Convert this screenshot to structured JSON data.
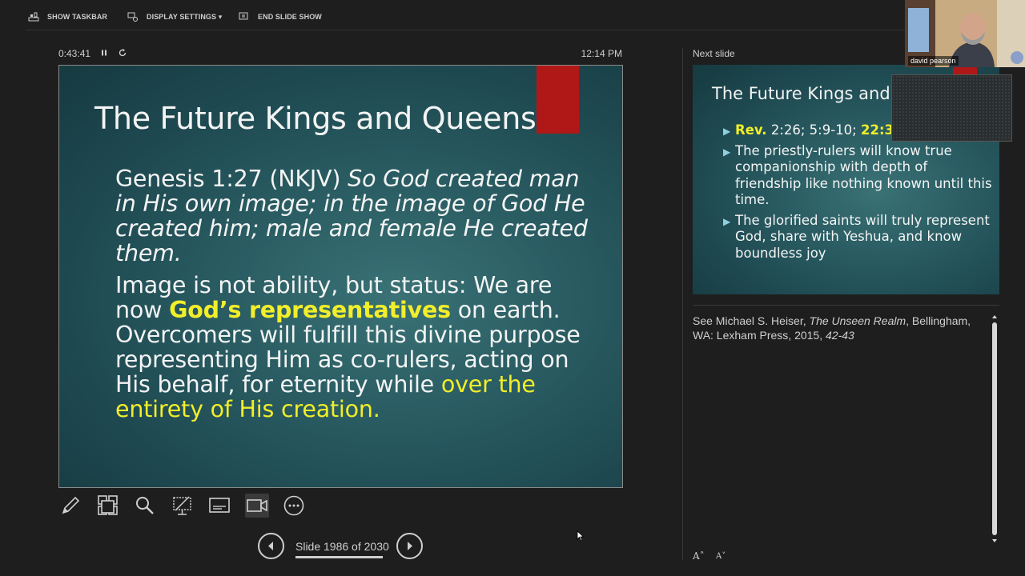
{
  "toolbar": {
    "show_taskbar": "SHOW TASKBAR",
    "display_settings": "DISPLAY SETTINGS ▾",
    "end_slide_show": "END SLIDE SHOW"
  },
  "status": {
    "timer": "0:43:41",
    "clock": "12:14 PM"
  },
  "current_slide": {
    "title": "The Future Kings and Queens",
    "verse_ref": "Genesis 1:27 (NKJV) ",
    "verse_text": "So God created man in His own image; in the image of God He created him; male and female He created them.",
    "p2_start": "Image is not ability, but status: We are now ",
    "p2_highlight": "God’s representatives",
    "p2_middle": " on earth. Overcomers will fulfill this divine purpose representing Him as co-rulers, acting on His behalf, for eternity while ",
    "p2_highlight2": "over the entirety of His creation."
  },
  "next_panel": {
    "label": "Next slide",
    "title": "The Future Kings and",
    "bullet1_a": "Rev.",
    "bullet1_b": " 2:26; 5:9-10; ",
    "bullet1_c": "22:3",
    "bullet2": "The priestly-rulers will know true companionship with depth of friendship like nothing known until this time.",
    "bullet3": "The glorified saints will truly represent God, share with Yeshua, and know boundless joy"
  },
  "notes": {
    "prefix": "See Michael S. Heiser, ",
    "book": "The Unseen Realm",
    "middle": ", Bellingham, WA: Lexham Press, 2015, ",
    "pages": "42-43"
  },
  "navigation": {
    "slide_count": "Slide 1986 of 2030",
    "progress": 0.978
  },
  "webcam": {
    "name": "david pearson"
  },
  "font_controls": {
    "increase": "A˄",
    "decrease": "A˅"
  },
  "colors": {
    "highlight": "#f2ee2a",
    "accent_red": "#b01818",
    "slide_bg": "#2a5d63"
  },
  "tools": [
    "pen-icon",
    "see-all-slides-icon",
    "zoom-icon",
    "pointer-screen-icon",
    "subtitles-icon",
    "camera-icon",
    "more-options-icon"
  ]
}
